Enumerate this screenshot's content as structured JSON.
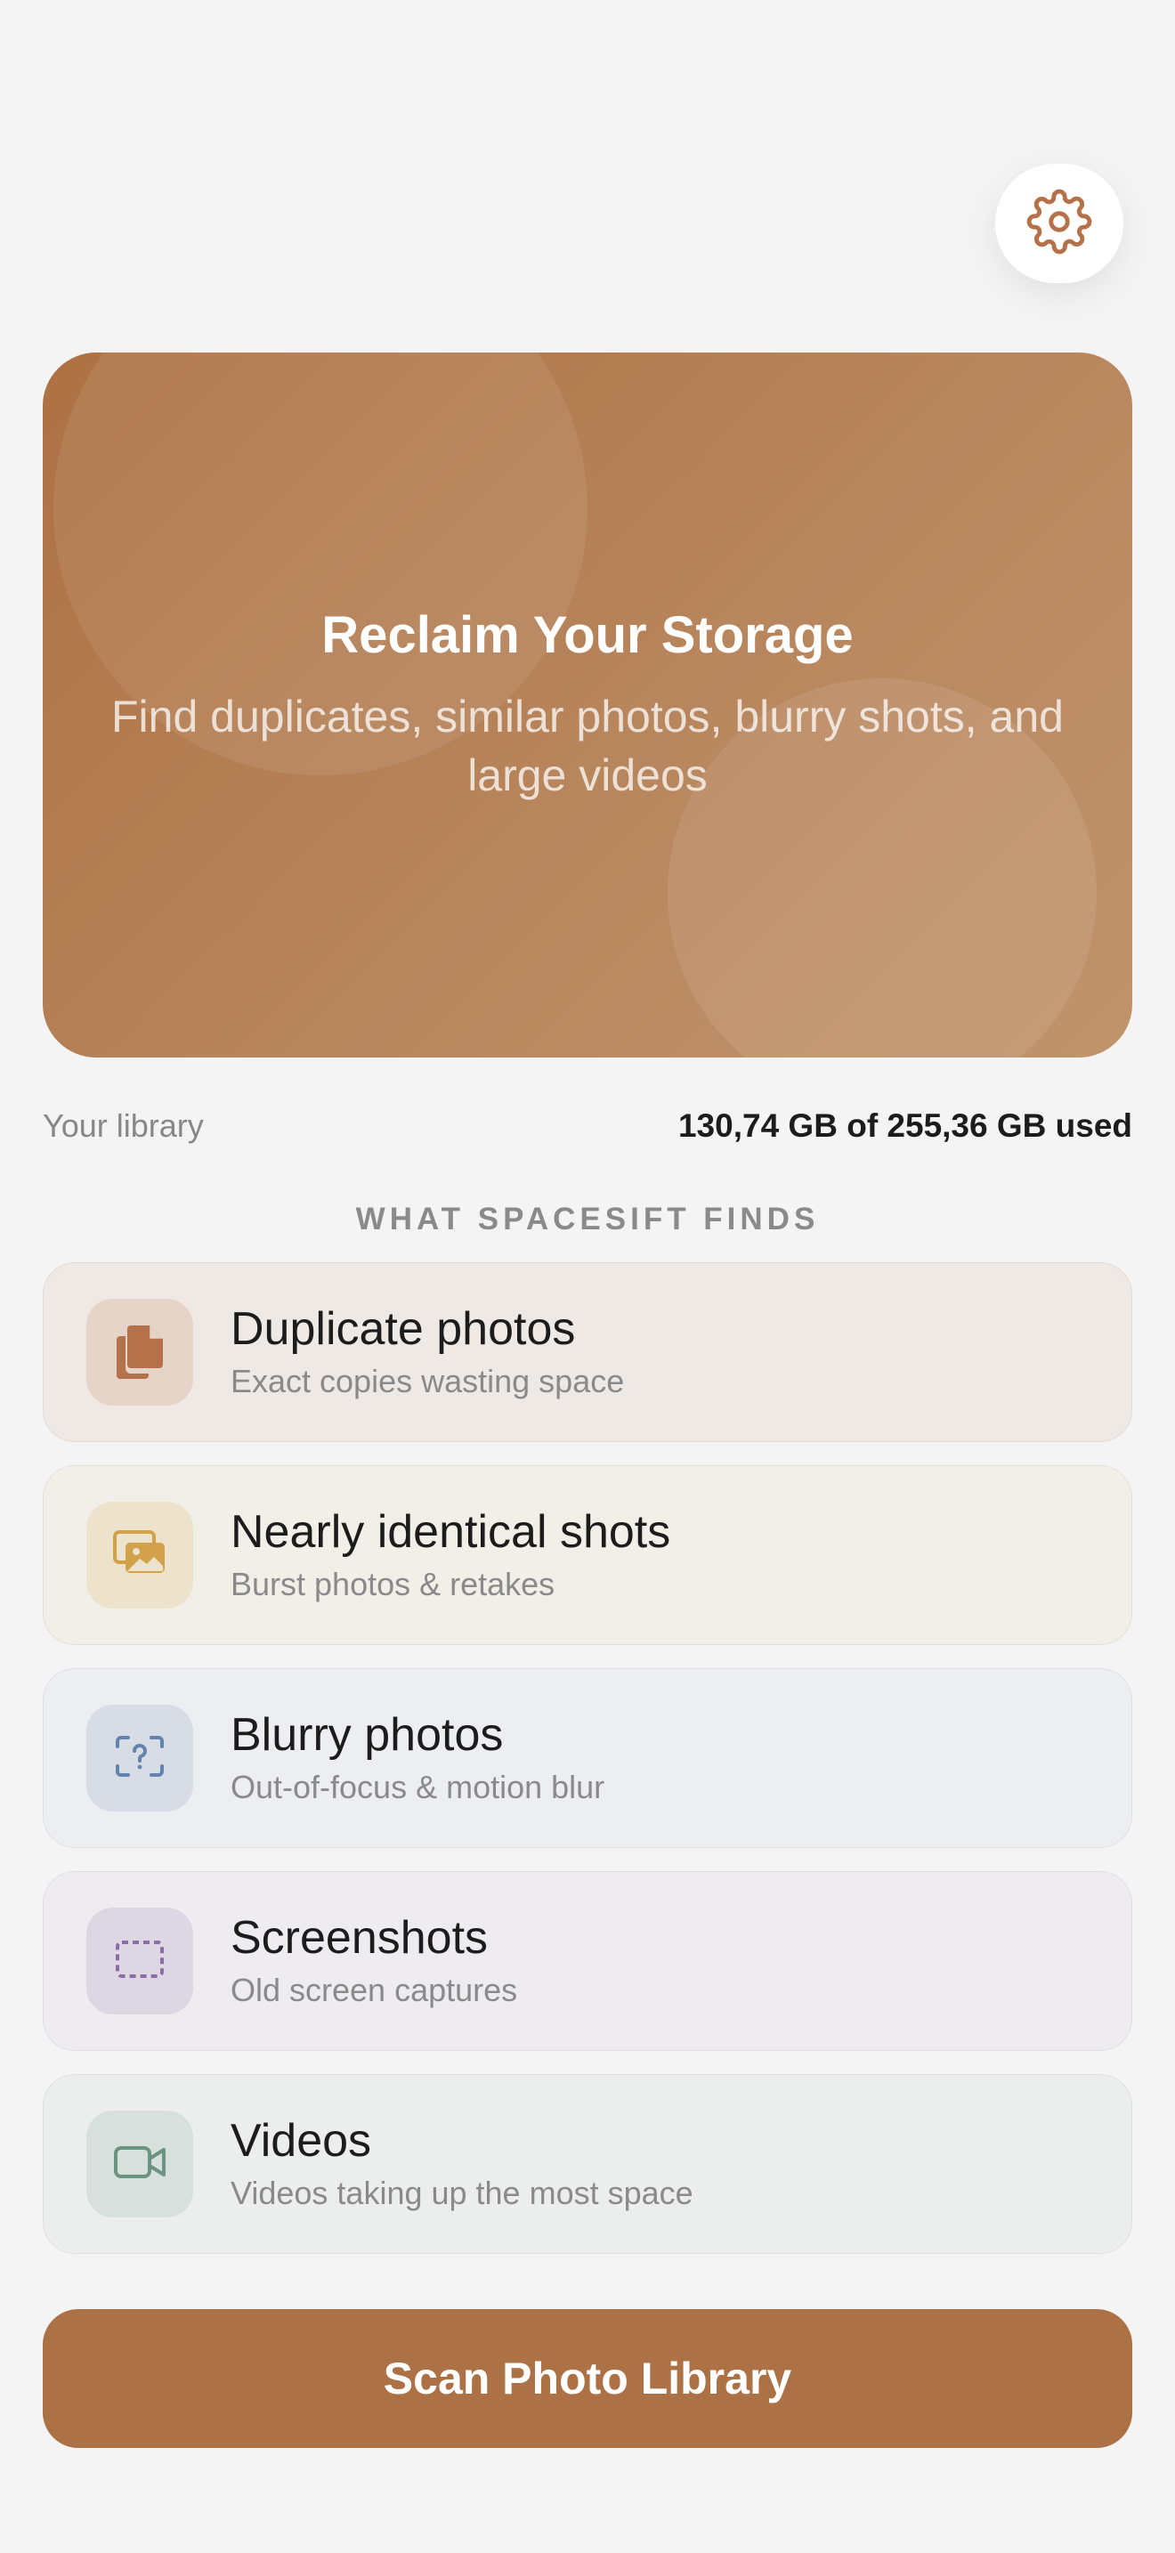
{
  "header": {
    "settings_icon": "gear-icon"
  },
  "hero": {
    "title": "Reclaim Your Storage",
    "subtitle": "Find duplicates, similar photos, blurry shots, and large videos"
  },
  "library": {
    "label": "Your library",
    "usage": "130,74 GB of 255,36 GB used"
  },
  "finds": {
    "heading": "WHAT SPACESIFT FINDS",
    "items": [
      {
        "title": "Duplicate photos",
        "subtitle": "Exact copies wasting space",
        "icon": "duplicate-files-icon",
        "color": "#b5724a"
      },
      {
        "title": "Nearly identical shots",
        "subtitle": "Burst photos & retakes",
        "icon": "photo-stack-icon",
        "color": "#d2a24b"
      },
      {
        "title": "Blurry photos",
        "subtitle": "Out-of-focus & motion blur",
        "icon": "blur-question-icon",
        "color": "#6483ad"
      },
      {
        "title": "Screenshots",
        "subtitle": "Old screen captures",
        "icon": "screenshot-icon",
        "color": "#8a6ca6"
      },
      {
        "title": "Videos",
        "subtitle": "Videos taking up the most space",
        "icon": "video-camera-icon",
        "color": "#6a9481"
      }
    ]
  },
  "scan": {
    "label": "Scan Photo Library"
  },
  "colors": {
    "accent": "#ad7146",
    "background": "#f4f4f4"
  }
}
